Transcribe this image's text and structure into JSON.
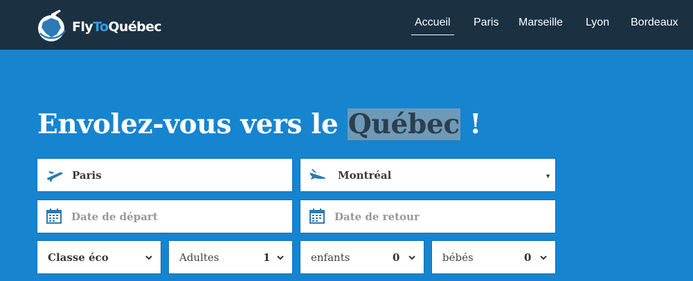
{
  "brand": {
    "part1": "Fly",
    "part2": "To",
    "part3": "Québec"
  },
  "nav": {
    "items": [
      {
        "label": "Accueil"
      },
      {
        "label": "Paris"
      },
      {
        "label": "Marseille"
      },
      {
        "label": "Lyon"
      },
      {
        "label": "Bordeaux"
      }
    ]
  },
  "hero": {
    "title_before": "Envolez-vous vers le ",
    "title_highlight": "Québec",
    "title_after": " !"
  },
  "search": {
    "from": {
      "value": "Paris",
      "icon": "plane-takeoff-icon"
    },
    "to": {
      "value": "Montréal",
      "icon": "plane-landing-icon"
    },
    "departure": {
      "placeholder": "Date de départ",
      "icon": "calendar-icon"
    },
    "return": {
      "placeholder": "Date de retour",
      "icon": "calendar-icon"
    },
    "class": {
      "value": "Classe éco"
    },
    "adults": {
      "label": "Adultes",
      "count": "1"
    },
    "children": {
      "label": "enfants",
      "count": "0"
    },
    "infants": {
      "label": "bébés",
      "count": "0"
    }
  },
  "colors": {
    "navbar": "#1b3142",
    "hero_bg": "#1784cf",
    "icon_blue": "#2a7ab5",
    "brand_accent": "#2ea0e6"
  }
}
